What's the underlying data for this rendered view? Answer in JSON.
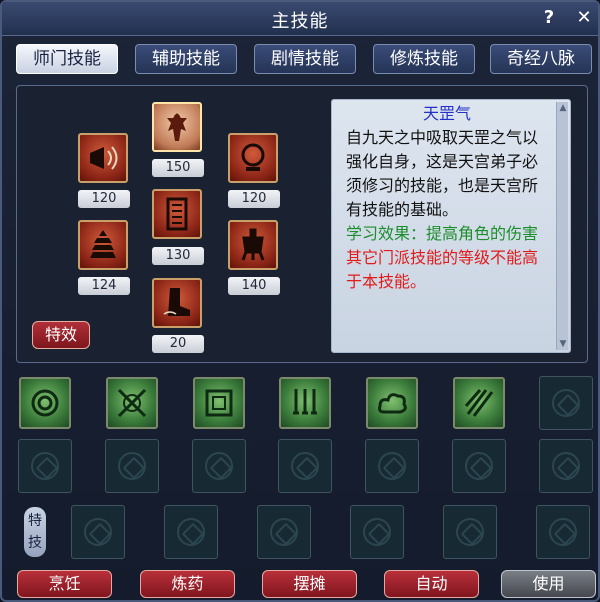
{
  "window": {
    "title": "主技能",
    "help_label": "?",
    "close_label": "✕"
  },
  "tabs": [
    {
      "label": "师门技能",
      "active": true
    },
    {
      "label": "辅助技能",
      "active": false
    },
    {
      "label": "剧情技能",
      "active": false
    },
    {
      "label": "修炼技能",
      "active": false
    },
    {
      "label": "奇经八脉",
      "active": false
    }
  ],
  "skills": [
    {
      "icon": "warrior-figure-icon",
      "level": "150",
      "selected": true
    },
    {
      "icon": "horn-icon",
      "level": "120"
    },
    {
      "icon": "mirror-icon",
      "level": "120"
    },
    {
      "icon": "scroll-icon",
      "level": "130"
    },
    {
      "icon": "pagoda-icon",
      "level": "124"
    },
    {
      "icon": "cauldron-icon",
      "level": "140"
    },
    {
      "icon": "boot-icon",
      "level": "20"
    }
  ],
  "effect_button": "特效",
  "description": {
    "title": "天罡气",
    "body": "自九天之中吸取天罡之气以强化自身，这是天宫弟子必须修习的技能，也是天宫所有技能的基础。",
    "effect": "学习效果：提高角色的伤害",
    "warning": "其它门派技能的等级不能高于本技能。"
  },
  "grid_skills": [
    {
      "icon": "shield-ring-icon"
    },
    {
      "icon": "crossed-sword-icon"
    },
    {
      "icon": "frame-icon"
    },
    {
      "icon": "daggers-icon"
    },
    {
      "icon": "cloud-icon"
    },
    {
      "icon": "claw-slash-icon"
    }
  ],
  "special_label": "特技",
  "bottom_buttons": [
    "烹饪",
    "炼药",
    "摆摊",
    "自动",
    "使用"
  ],
  "colors": {
    "accent_red": "#b0303a",
    "desc_title": "#2230c8",
    "desc_green": "#1b8e2a",
    "desc_red": "#e11a1a"
  }
}
